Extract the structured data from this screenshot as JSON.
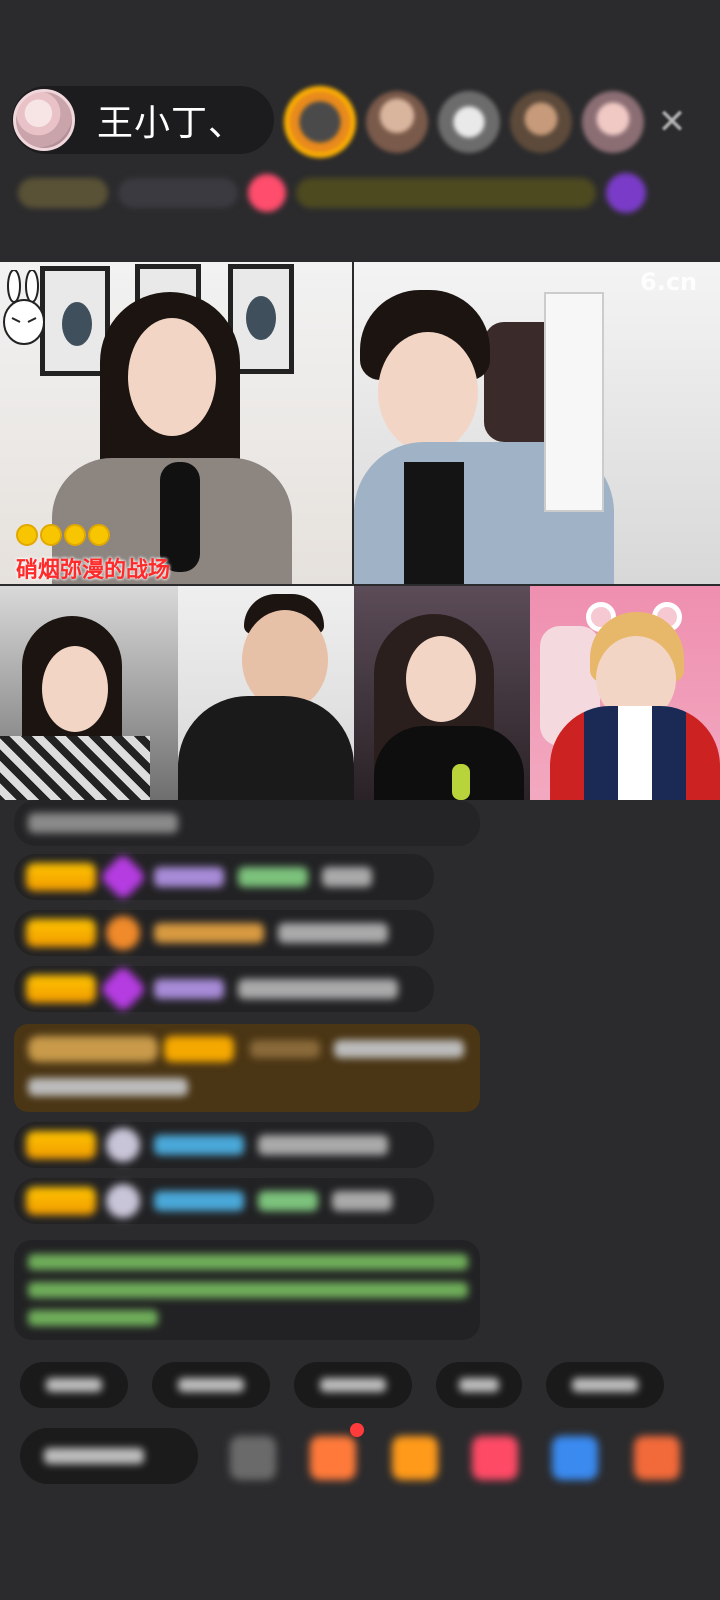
{
  "host": {
    "name": "王小丁、"
  },
  "viewers": [
    "viewer-1",
    "viewer-2",
    "viewer-3",
    "viewer-4",
    "viewer-5"
  ],
  "icons": {
    "close": "close-icon"
  },
  "stream": {
    "title": "硝烟弥漫的战场",
    "watermark": "6.cn"
  },
  "colors": {
    "background": "#2b2b2d",
    "badge": "#f5a800",
    "title_red": "#ff2a2a"
  }
}
